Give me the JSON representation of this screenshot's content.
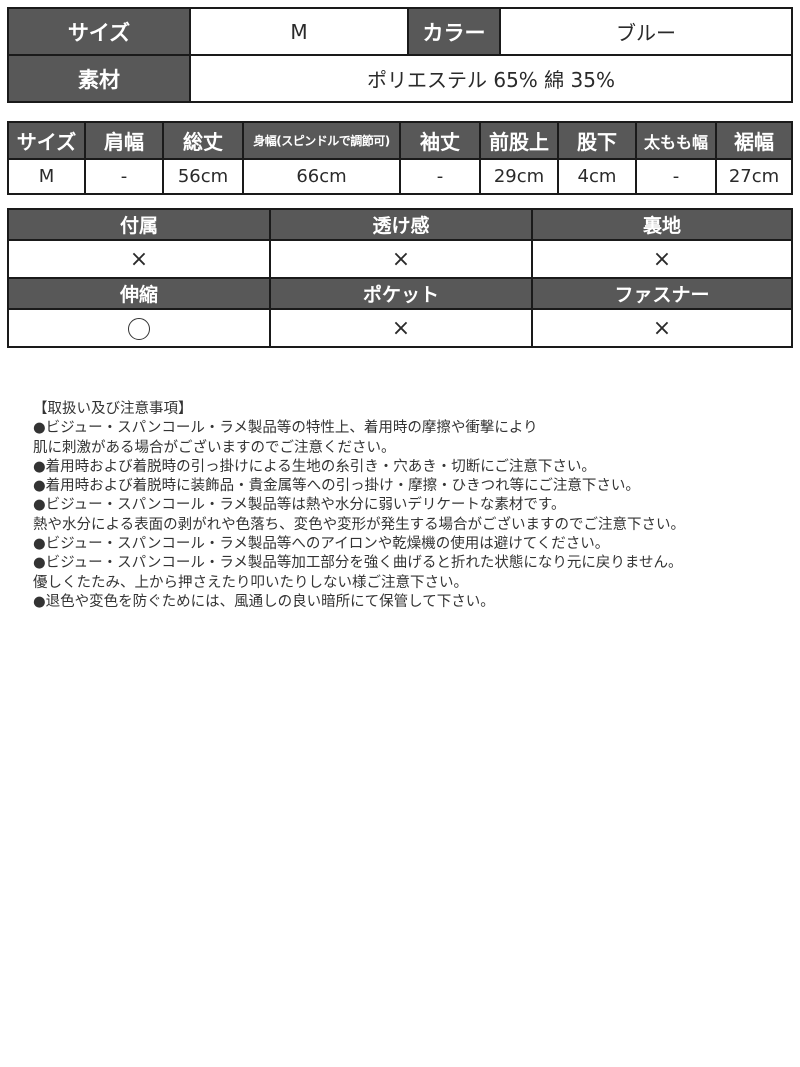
{
  "spec_table": {
    "size_label": "サイズ",
    "size_value": "M",
    "color_label": "カラー",
    "color_value": "ブルー",
    "material_label": "素材",
    "material_value": "ポリエステル 65%  綿 35%"
  },
  "measure_table": {
    "headers": [
      "サイズ",
      "肩幅",
      "総丈",
      "身幅(スピンドルで調節可)",
      "袖丈",
      "前股上",
      "股下",
      "太もも幅",
      "裾幅"
    ],
    "rows": [
      [
        "M",
        "-",
        "56cm",
        "66cm",
        "-",
        "29cm",
        "4cm",
        "-",
        "27cm"
      ]
    ]
  },
  "feature_table": {
    "row1_headers": [
      "付属",
      "透け感",
      "裏地"
    ],
    "row1_values": [
      "×",
      "×",
      "×"
    ],
    "row2_headers": [
      "伸縮",
      "ポケット",
      "ファスナー"
    ],
    "row2_values": [
      "○",
      "×",
      "×"
    ]
  },
  "notes": {
    "title": "【取扱い及び注意事項】",
    "lines": [
      "●ビジュー・スパンコール・ラメ製品等の特性上、着用時の摩擦や衝撃により",
      "肌に刺激がある場合がございますのでご注意ください。",
      "●着用時および着脱時の引っ掛けによる生地の糸引き・穴あき・切断にご注意下さい。",
      "●着用時および着脱時に装飾品・貴金属等への引っ掛け・摩擦・ひきつれ等にご注意下さい。",
      "●ビジュー・スパンコール・ラメ製品等は熱や水分に弱いデリケートな素材です。",
      "熱や水分による表面の剥がれや色落ち、変色や変形が発生する場合がございますのでご注意下さい。",
      "●ビジュー・スパンコール・ラメ製品等へのアイロンや乾燥機の使用は避けてください。",
      "●ビジュー・スパンコール・ラメ製品等加工部分を強く曲げると折れた状態になり元に戻りません。",
      "優しくたたみ、上から押さえたり叩いたりしない様ご注意下さい。",
      "●退色や変色を防ぐためには、風通しの良い暗所にて保管して下さい。"
    ]
  }
}
